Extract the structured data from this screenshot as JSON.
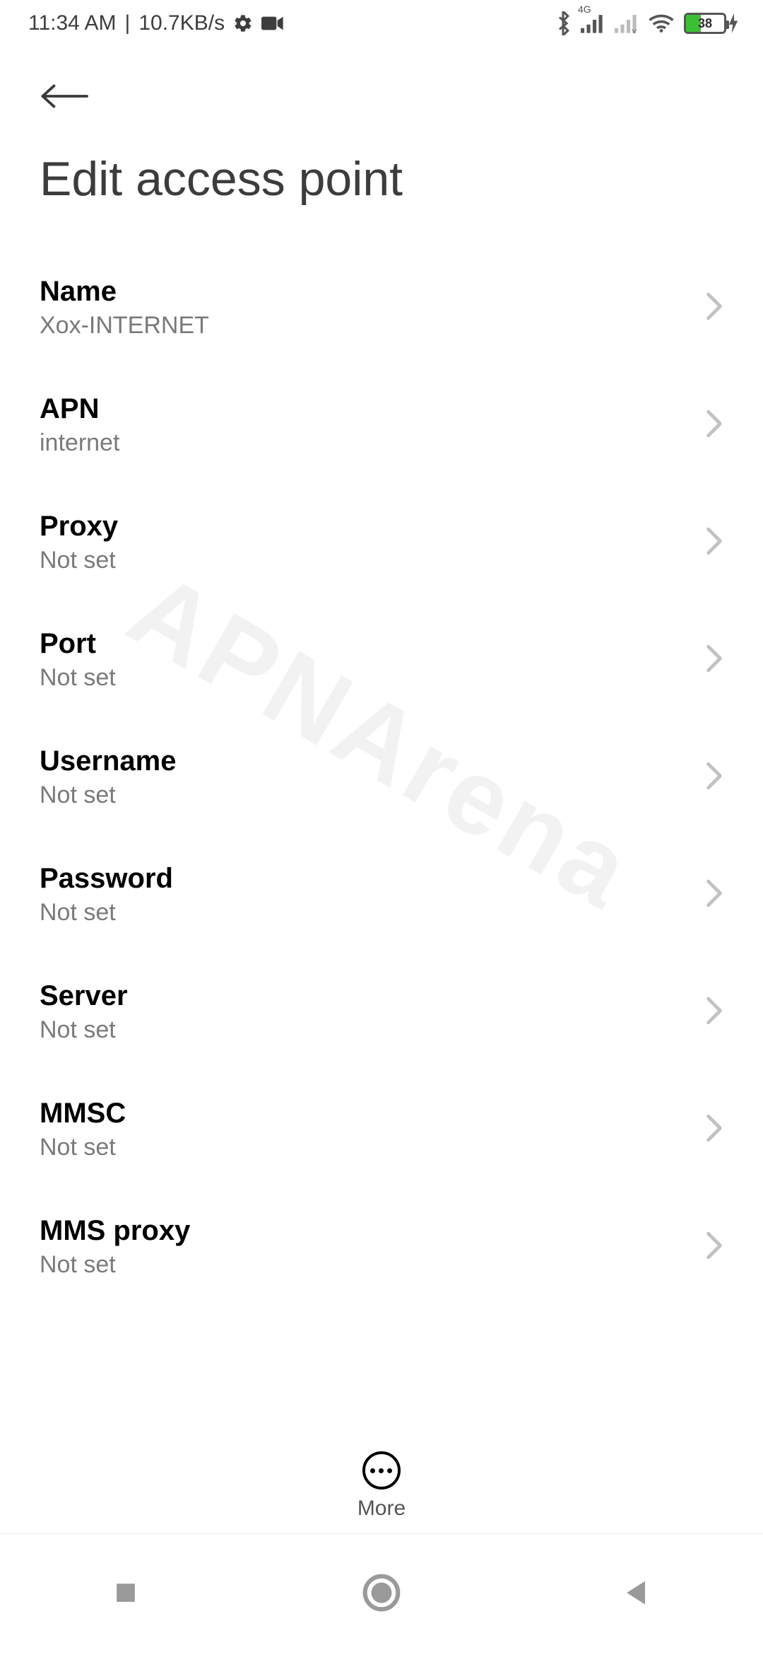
{
  "status": {
    "time": "11:34 AM",
    "speed": "10.7KB/s",
    "network_badge": "4G",
    "battery_percent": 38
  },
  "header": {
    "title": "Edit access point"
  },
  "settings": [
    {
      "label": "Name",
      "value": "Xox-INTERNET"
    },
    {
      "label": "APN",
      "value": "internet"
    },
    {
      "label": "Proxy",
      "value": "Not set"
    },
    {
      "label": "Port",
      "value": "Not set"
    },
    {
      "label": "Username",
      "value": "Not set"
    },
    {
      "label": "Password",
      "value": "Not set"
    },
    {
      "label": "Server",
      "value": "Not set"
    },
    {
      "label": "MMSC",
      "value": "Not set"
    },
    {
      "label": "MMS proxy",
      "value": "Not set"
    }
  ],
  "footer": {
    "more_label": "More"
  },
  "watermark": "APNArena"
}
